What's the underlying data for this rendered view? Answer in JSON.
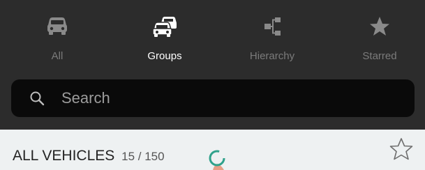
{
  "tabs": [
    {
      "label": "All",
      "icon": "car-icon",
      "active": false
    },
    {
      "label": "Groups",
      "icon": "cars-group-icon",
      "active": true
    },
    {
      "label": "Hierarchy",
      "icon": "hierarchy-icon",
      "active": false
    },
    {
      "label": "Starred",
      "icon": "star-icon",
      "active": false
    }
  ],
  "search": {
    "placeholder": "Search",
    "value": "",
    "icon": "search-icon"
  },
  "list_header": {
    "title": "ALL VEHICLES",
    "count": "15 / 150",
    "star_icon": "star-outline-icon"
  },
  "colors": {
    "topbar": "#2c2c2c",
    "search_bg": "#0a0a0a",
    "active_label": "#ffffff",
    "inactive_label": "#7b7b7b",
    "active_icon": "#ffffff",
    "inactive_icon": "#8a8a8a",
    "list_bg": "#eef1f2",
    "loader_ring": "#2fa28b",
    "loader_tail": "#e89e86"
  }
}
